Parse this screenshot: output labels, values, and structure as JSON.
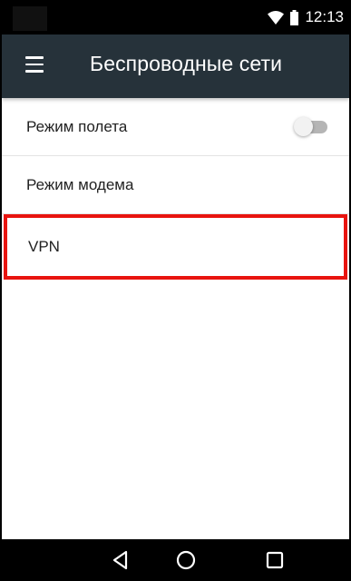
{
  "status_bar": {
    "time": "12:13",
    "icons": [
      "wifi-icon",
      "battery-icon"
    ]
  },
  "app_bar": {
    "title": "Беспроводные сети",
    "menu_icon": "menu-icon"
  },
  "settings": {
    "items": [
      {
        "label": "Режим полета",
        "toggle": false
      },
      {
        "label": "Режим модема"
      },
      {
        "label": "VPN",
        "highlighted": true
      }
    ]
  },
  "nav_bar": {
    "buttons": [
      "back-icon",
      "home-icon",
      "recents-icon"
    ]
  },
  "colors": {
    "app_bar": "#26323a",
    "highlight_border": "#e8140f",
    "status_bar": "#000000"
  }
}
